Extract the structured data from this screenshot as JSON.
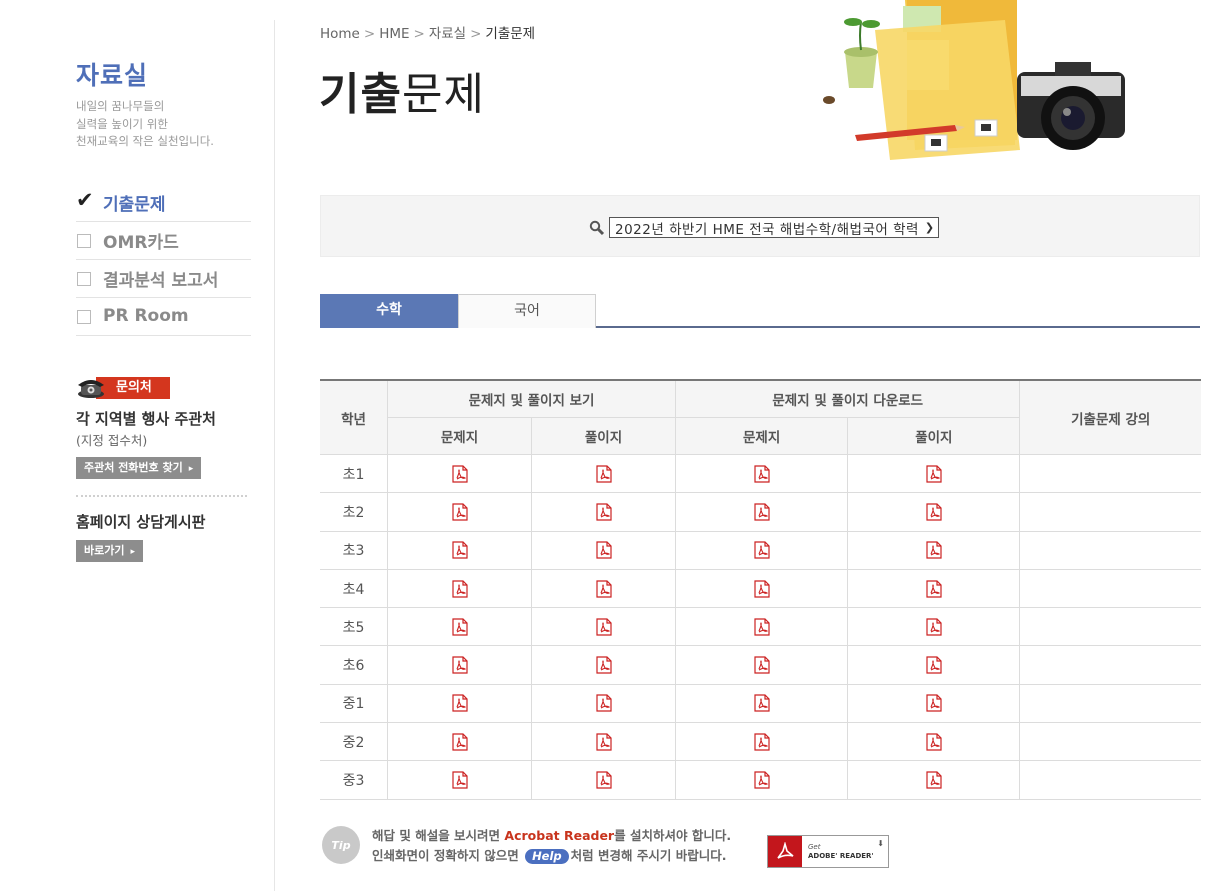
{
  "sidebar": {
    "title": "자료실",
    "desc_lines": [
      "내일의 꿈나무들의",
      "실력을 높이기 위한",
      "천재교육의 작은 실천입니다."
    ],
    "menu": [
      {
        "label": "기출문제",
        "active": true
      },
      {
        "label": "OMR카드",
        "active": false
      },
      {
        "label": "결과분석 보고서",
        "active": false
      },
      {
        "label": "PR Room",
        "active": false
      }
    ],
    "contact": {
      "tag": "문의처",
      "main": "각 지역별 행사 주관처",
      "sub": "(지정 접수처)",
      "button": "주관처 전화번호 찾기",
      "board_title": "홈페이지 상담게시판",
      "board_button": "바로가기"
    }
  },
  "breadcrumb": [
    "Home",
    "HME",
    "자료실",
    "기출문제"
  ],
  "page_title": {
    "bold": "기출",
    "light": "문제"
  },
  "search": {
    "selected_exam": "2022년 하반기 HME 전국 해법수학/해법국어 학력"
  },
  "tabs": [
    {
      "label": "수학",
      "active": true
    },
    {
      "label": "국어",
      "active": false
    }
  ],
  "table": {
    "grade_header": "학년",
    "view_group": "문제지 및 풀이지 보기",
    "download_group": "문제지 및 풀이지 다운로드",
    "lecture_header": "기출문제 강의",
    "sub_headers": [
      "문제지",
      "풀이지",
      "문제지",
      "풀이지"
    ],
    "rows": [
      "초1",
      "초2",
      "초3",
      "초4",
      "초5",
      "초6",
      "중1",
      "중2",
      "중3"
    ]
  },
  "tip": {
    "badge": "Tip",
    "line1_pre": "해답 및 해설을 보시려면 ",
    "line1_red": "Acrobat Reader",
    "line1_post": "를 설치하셔야 합니다.",
    "line2_pre": "인쇄화면이 정확하지 않으면 ",
    "help": "Help",
    "line2_post": "처럼 변경해 주시기 바랍니다."
  },
  "adobe": {
    "get": "Get",
    "name": "ADOBE' READER'"
  }
}
